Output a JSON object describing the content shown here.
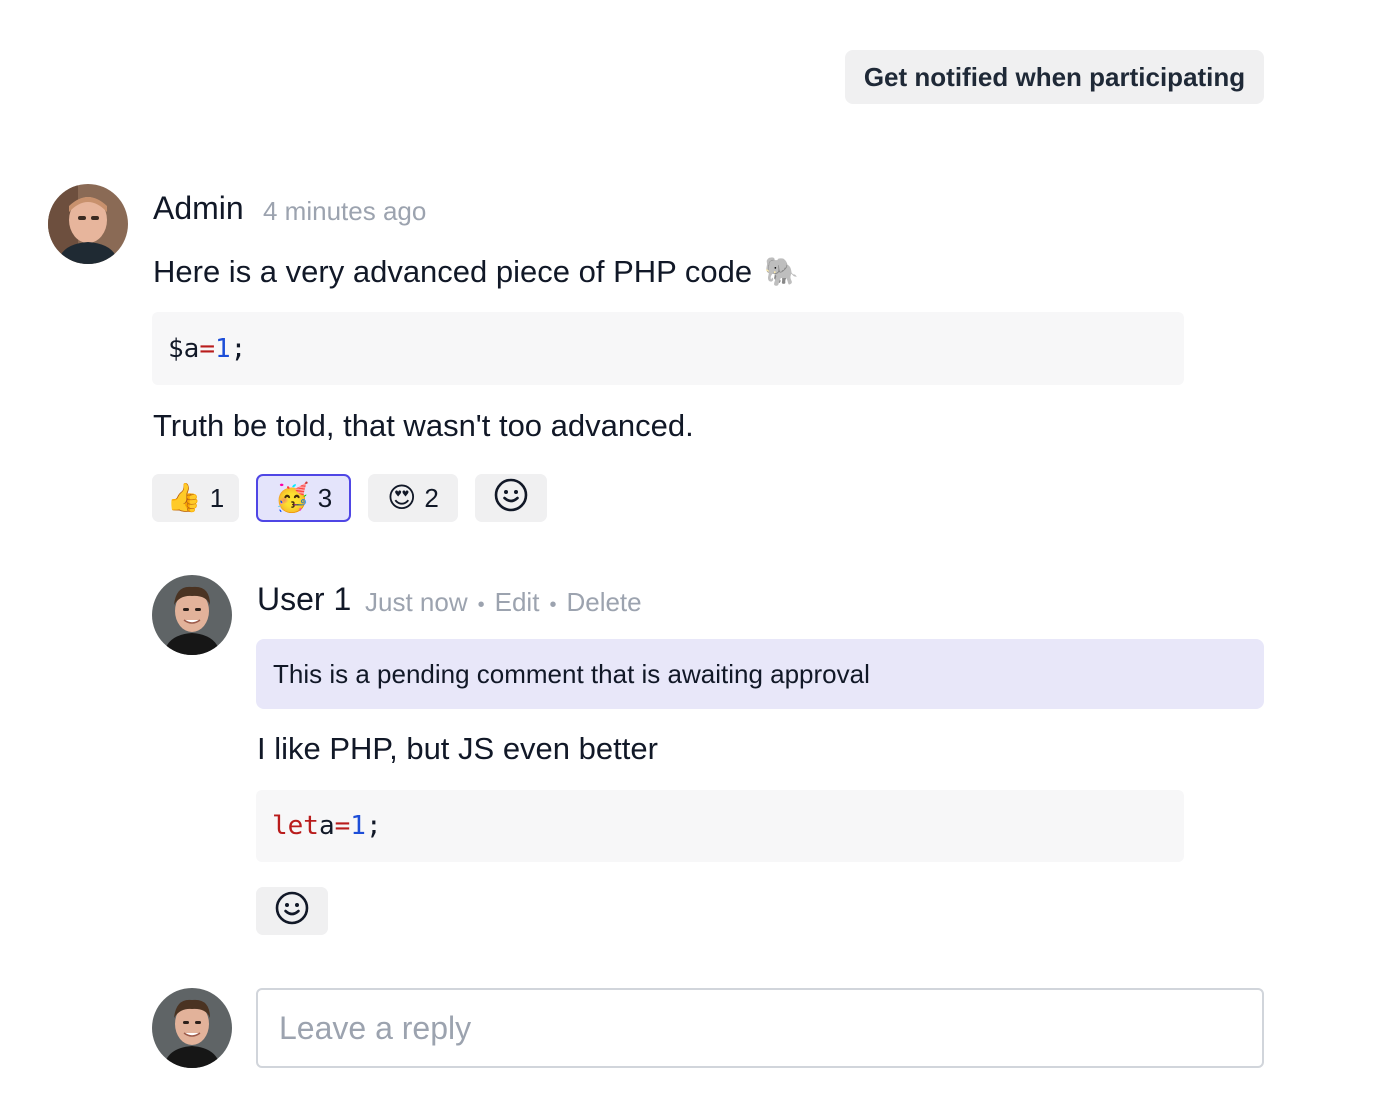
{
  "header": {
    "notify_label": "Get notified when participating"
  },
  "comment": {
    "author": "Admin",
    "time": "4 minutes ago",
    "intro_text": "Here is a very advanced piece of PHP code",
    "intro_emoji": "🐘",
    "code": {
      "var": "$a",
      "op": "=",
      "num": "1",
      "end": ";"
    },
    "outro_text": "Truth be told, that wasn't too advanced.",
    "reactions": [
      {
        "emoji": "👍",
        "count": "1",
        "active": false
      },
      {
        "emoji": "🥳",
        "count": "3",
        "active": true
      },
      {
        "emoji": "😍",
        "count": "2",
        "active": false
      }
    ],
    "add_reaction_icon": "smiley-icon"
  },
  "reply": {
    "author": "User 1",
    "time": "Just now",
    "edit_label": "Edit",
    "delete_label": "Delete",
    "pending_notice": "This is a pending comment that is awaiting approval",
    "text": "I like PHP, but JS even better",
    "code": {
      "kw": "let",
      "var": "a",
      "op": "=",
      "num": "1",
      "end": ";"
    },
    "add_reaction_icon": "smiley-icon"
  },
  "compose": {
    "placeholder": "Leave a reply"
  },
  "colors": {
    "accent": "#4f46e5",
    "pending_bg": "#e8e7f9",
    "muted": "#9ca3af"
  }
}
